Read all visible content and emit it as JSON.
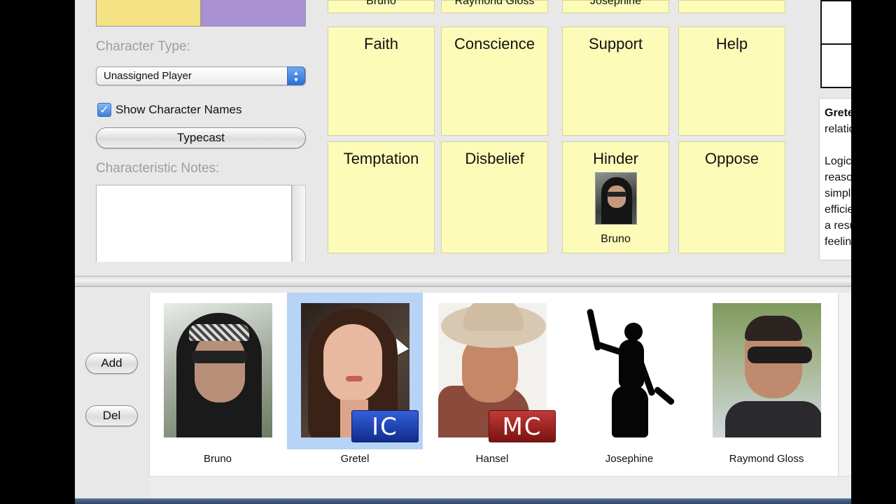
{
  "left_panel": {
    "character_type_label": "Character Type:",
    "character_type_value": "Unassigned Player",
    "show_names_label": "Show Character Names",
    "show_names_checked": "✓",
    "typecast_label": "Typecast",
    "notes_label": "Characteristic Notes:"
  },
  "grid": {
    "partial_row": [
      "Bruno",
      "Raymond Gloss",
      "Josephine",
      ""
    ],
    "row1": [
      "Faith",
      "Conscience",
      "Support",
      "Help"
    ],
    "row2": [
      "Temptation",
      "Disbelief",
      "Hinder",
      "Oppose"
    ],
    "hinder_member": "Bruno"
  },
  "description": {
    "name": "Gretel",
    "lines": [
      "relationship",
      "",
      "Logic",
      "reason",
      "simple",
      "efficient",
      "a result",
      "feeling"
    ]
  },
  "cast": {
    "add_label": "Add",
    "del_label": "Del",
    "members": [
      {
        "name": "Bruno",
        "badge": ""
      },
      {
        "name": "Gretel",
        "badge": "IC"
      },
      {
        "name": "Hansel",
        "badge": "MC"
      },
      {
        "name": "Josephine",
        "badge": ""
      },
      {
        "name": "Raymond Gloss",
        "badge": ""
      }
    ]
  },
  "colors": {
    "swatch_yellow": "#f4e285",
    "swatch_purple": "#a991d4",
    "cell_yellow": "#fdfbb8",
    "selection": "#b7d3f5",
    "ic_badge": "#1e43b5",
    "mc_badge": "#a0201e"
  }
}
